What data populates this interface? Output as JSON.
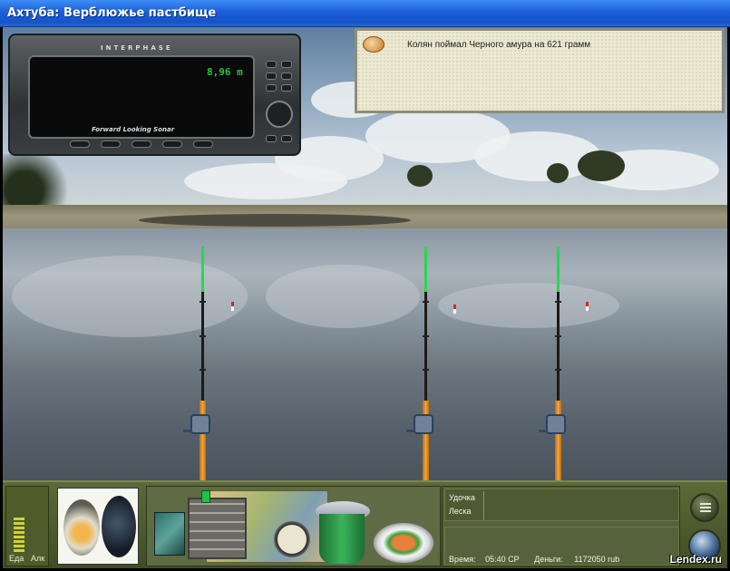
{
  "window": {
    "title": "Ахтуба: Верблюжье пастбище"
  },
  "sonar": {
    "brand": "INTERPHASE",
    "depth": "8,96 m",
    "label": "Forward Looking Sonar"
  },
  "message": {
    "text": "Колян поймал Черного амура на 621 грамм",
    "icon": "worm-icon"
  },
  "meters": {
    "food_label": "Еда",
    "alcohol_label": "Алк"
  },
  "info": {
    "rod_label": "Удочка",
    "line_label": "Леска",
    "time_label": "Время:",
    "time_value": "05:40 СР",
    "money_label": "Деньги:",
    "money_value": "1172050 rub"
  },
  "watermark": "Lendex.ru",
  "colors": {
    "titlebar": "#1c5ed8",
    "rod_tip": "#28d84a",
    "panel": "#4f5b2b",
    "depth_text": "#2cc241"
  }
}
